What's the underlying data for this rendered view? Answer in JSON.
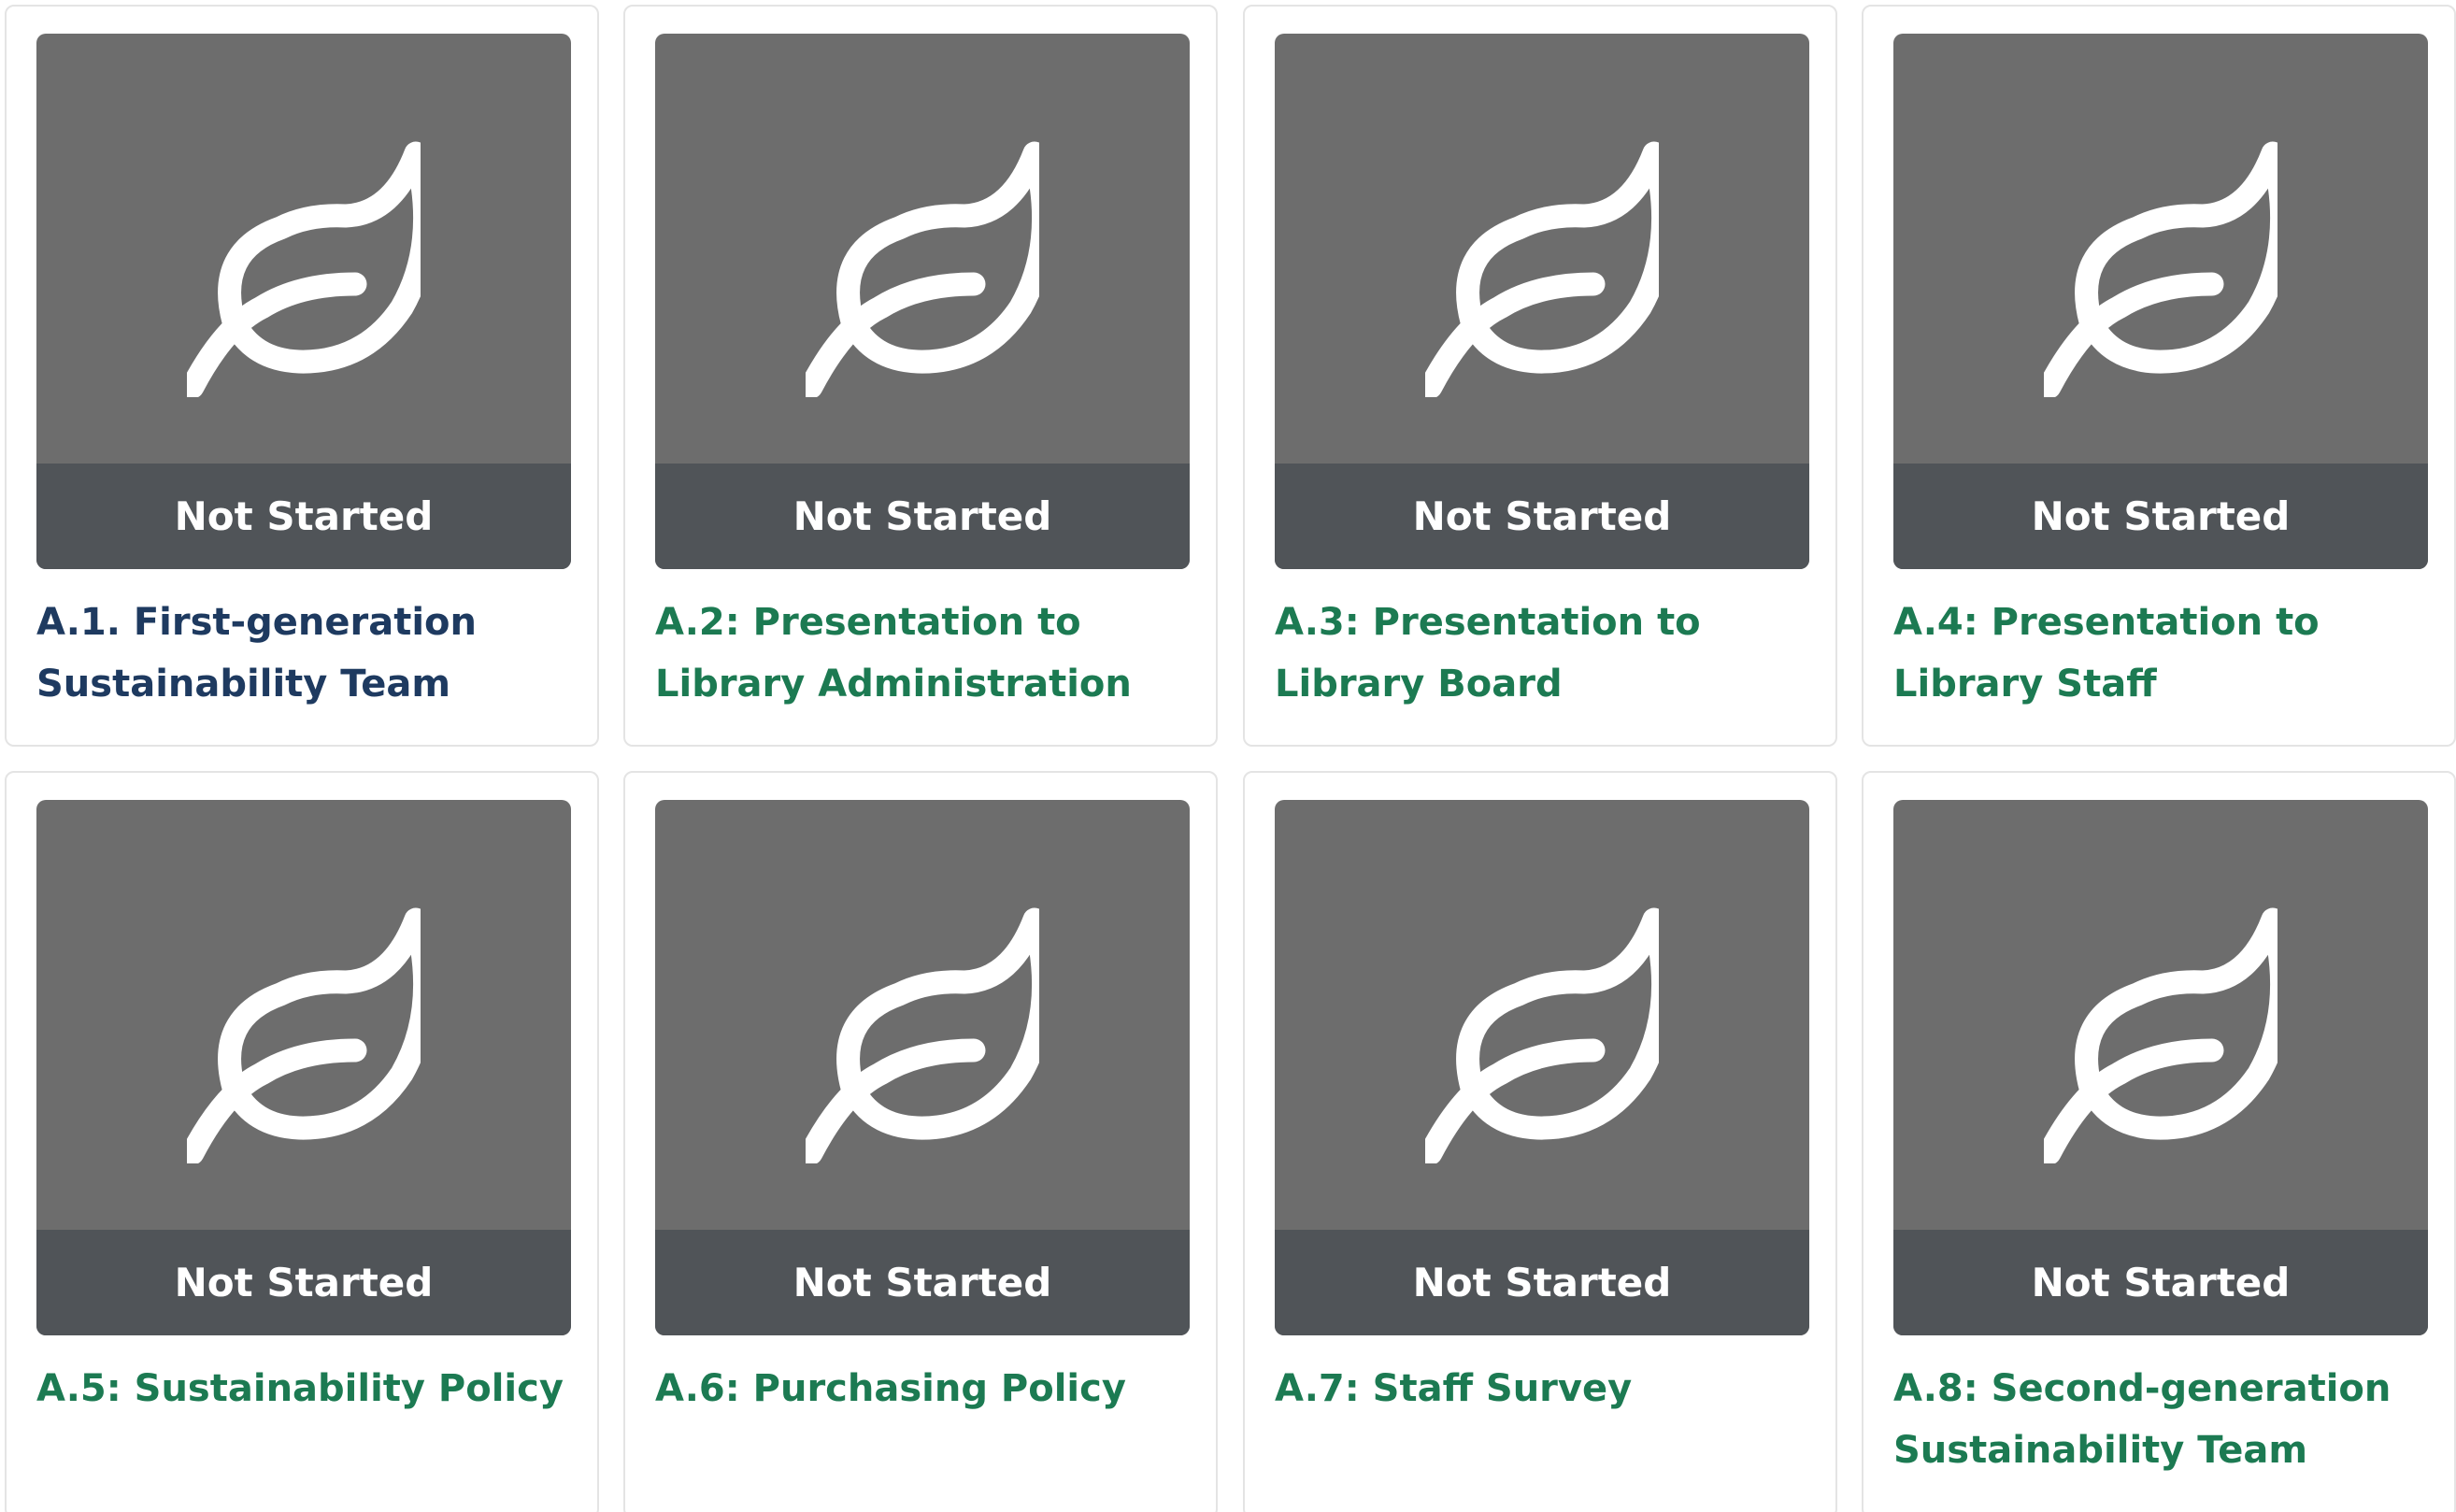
{
  "colors": {
    "thumbnail_bg": "#6d6d6d",
    "status_bar_bg": "#505458",
    "title_green": "#1c7a52",
    "title_navy": "#1e3a60",
    "card_border": "#e4e4e4"
  },
  "cards": [
    {
      "status": "Not Started",
      "title": "A.1. First-generation Sustainability Team",
      "icon": "leaf-icon"
    },
    {
      "status": "Not Started",
      "title": "A.2: Presentation to Library Administration",
      "icon": "leaf-icon"
    },
    {
      "status": "Not Started",
      "title": "A.3: Presentation to Library Board",
      "icon": "leaf-icon"
    },
    {
      "status": "Not Started",
      "title": "A.4: Presentation to Library Staff",
      "icon": "leaf-icon"
    },
    {
      "status": "Not Started",
      "title": "A.5: Sustainability Policy",
      "icon": "leaf-icon"
    },
    {
      "status": "Not Started",
      "title": "A.6: Purchasing Policy",
      "icon": "leaf-icon"
    },
    {
      "status": "Not Started",
      "title": "A.7: Staff Survey",
      "icon": "leaf-icon"
    },
    {
      "status": "Not Started",
      "title": "A.8: Second-generation Sustainability Team",
      "icon": "leaf-icon"
    }
  ]
}
